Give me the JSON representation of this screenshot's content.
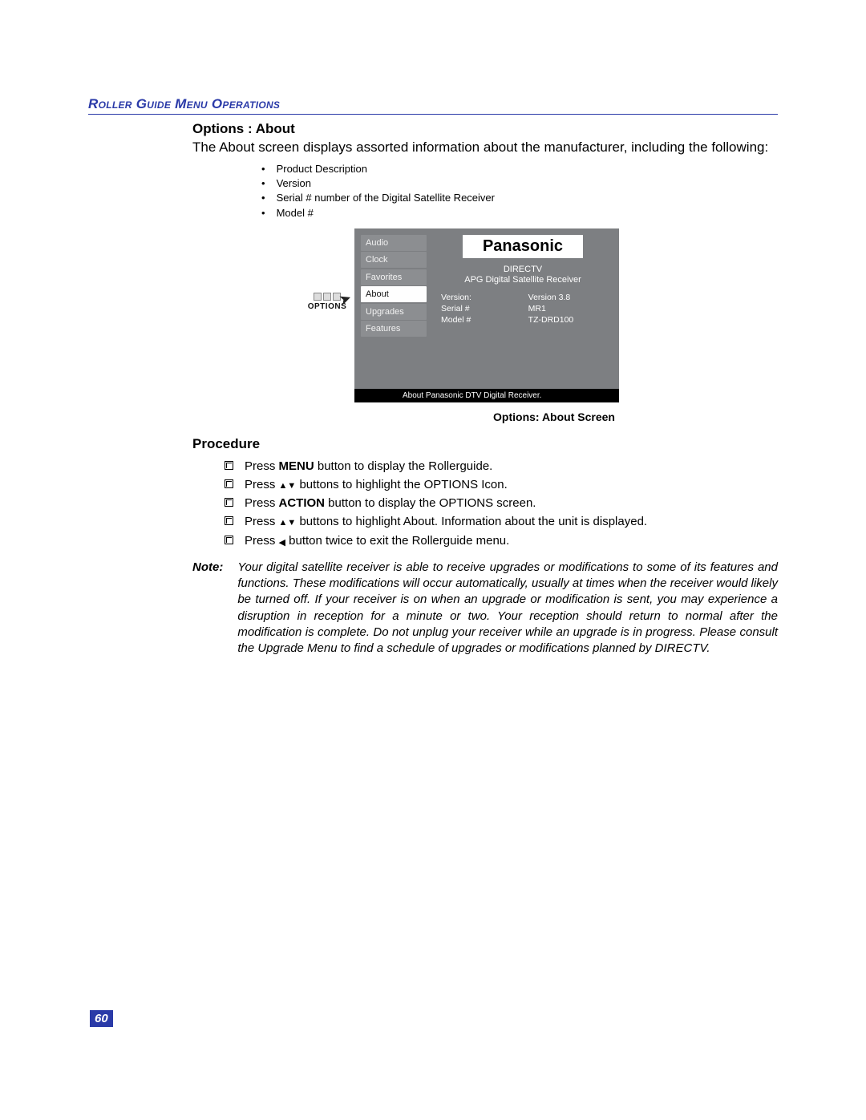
{
  "header": {
    "section_title": "Roller Guide Menu Operations"
  },
  "subhead": "Options : About",
  "intro": "The About screen displays assorted information about the manufacturer, including the following:",
  "about_bullets": [
    "Product Description",
    "Version",
    "Serial # number of the Digital Satellite Receiver",
    "Model #"
  ],
  "pointer_label": "OPTIONS",
  "tv": {
    "menu": [
      "Audio",
      "Clock",
      "Favorites",
      "About",
      "Upgrades",
      "Features"
    ],
    "selected_index": 3,
    "brand": "Panasonic",
    "provider": "DIRECTV",
    "product_desc": "APG Digital Satellite Receiver",
    "rows": [
      {
        "label": "Version:",
        "value": "Version 3.8"
      },
      {
        "label": "Serial #",
        "value": "MR1"
      },
      {
        "label": "Model #",
        "value": "TZ-DRD100"
      }
    ],
    "footer": "About Panasonic DTV Digital Receiver."
  },
  "caption": "Options: About Screen",
  "procedure_head": "Procedure",
  "steps": {
    "s1_a": "Press ",
    "s1_b": "MENU",
    "s1_c": " button to display the Rollerguide.",
    "s2_a": "Press ",
    "s2_b": " buttons to highlight the OPTIONS Icon.",
    "s3_a": "Press ",
    "s3_b": "ACTION",
    "s3_c": " button to display the OPTIONS screen.",
    "s4_a": "Press ",
    "s4_b": " buttons to highlight About. Information about the unit is displayed.",
    "s5_a": "Press  ",
    "s5_b": " button twice to exit the Rollerguide menu."
  },
  "note_label": "Note:",
  "note_body": "Your digital satellite receiver is able to receive upgrades or modifications to some of its features and functions. These modifications will occur automatically, usually at times when the receiver would likely be turned off. If your receiver is on when an upgrade or modification is sent, you may experience a disruption in reception for a minute or two. Your reception should return to normal after the modification is complete. Do not unplug your receiver while an upgrade is in progress. Please consult the Upgrade Menu to find a schedule of upgrades or modifications planned by DIRECTV.",
  "page_number": "60"
}
